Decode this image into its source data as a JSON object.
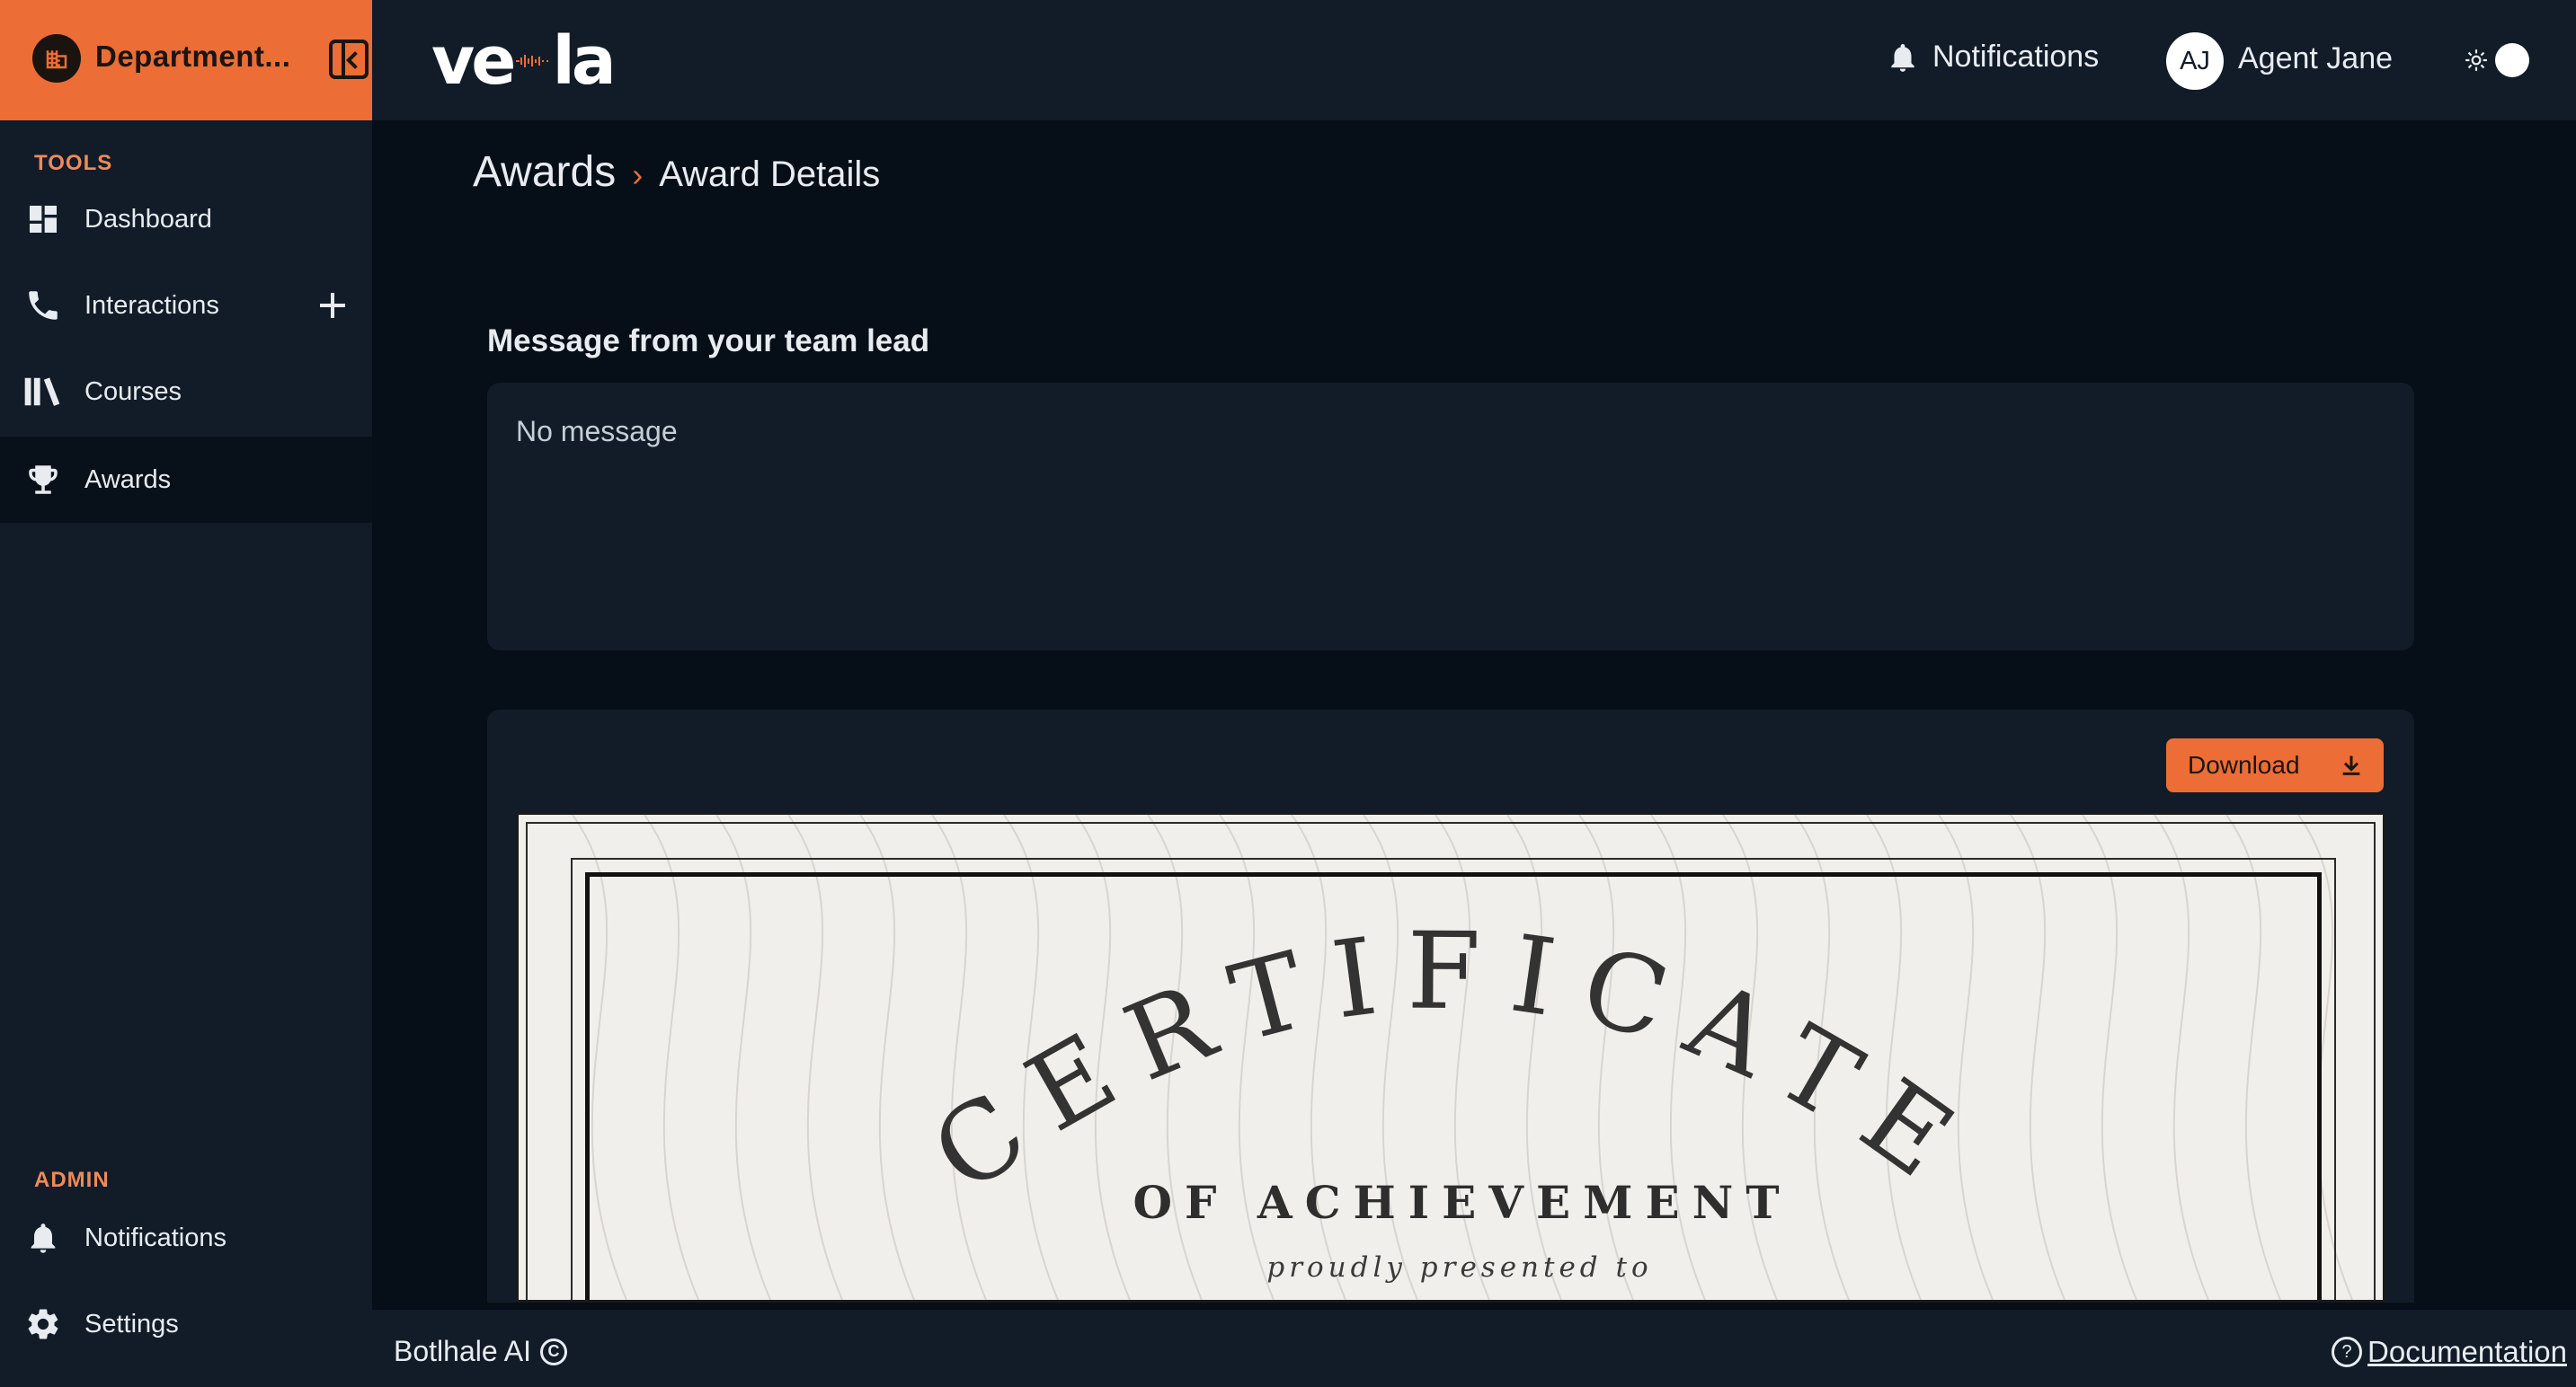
{
  "department": {
    "label": "Department...",
    "icon": "building-icon"
  },
  "sidebar": {
    "tools_label": "TOOLS",
    "admin_label": "ADMIN",
    "items": [
      {
        "label": "Dashboard",
        "icon": "dashboard-icon"
      },
      {
        "label": "Interactions",
        "icon": "phone-icon"
      },
      {
        "label": "Courses",
        "icon": "library-icon"
      },
      {
        "label": "Awards",
        "icon": "trophy-icon"
      }
    ],
    "admin_items": [
      {
        "label": "Notifications",
        "icon": "bell-icon"
      },
      {
        "label": "Settings",
        "icon": "gear-icon"
      }
    ]
  },
  "header": {
    "logo_text_left": "ve",
    "logo_text_right": "la",
    "notifications_label": "Notifications",
    "avatar_initials": "AJ",
    "user_name": "Agent Jane"
  },
  "breadcrumb": {
    "root": "Awards",
    "separator": "›",
    "current": "Award Details"
  },
  "message": {
    "title": "Message from your team lead",
    "text": "No message"
  },
  "certificate": {
    "download_label": "Download",
    "title": "CERTIFICATE",
    "subtitle": "OF ACHIEVEMENT",
    "presented": "proudly presented to"
  },
  "footer": {
    "brand": "Botlhale AI",
    "copyright_symbol": "C",
    "docs_label": "Documentation"
  },
  "colors": {
    "accent": "#ec6d35",
    "panel": "#111c28",
    "background": "#060f18"
  }
}
